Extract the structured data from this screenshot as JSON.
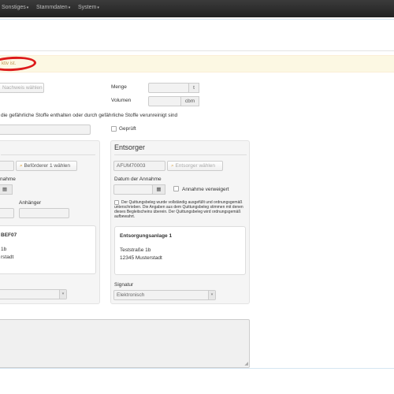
{
  "nav": {
    "items": [
      {
        "label": "Sonstiges"
      },
      {
        "label": "Stammdaten"
      },
      {
        "label": "System"
      }
    ]
  },
  "alert": {
    "text": "ktiv ist."
  },
  "top": {
    "nachweis_button": "Nachweis wählen",
    "menge_label": "Menge",
    "menge_unit": "t",
    "volumen_label": "Volumen",
    "volumen_unit": "cbm",
    "stoffe_text": "die gefährliche Stoffe enthalten oder durch gefährliche Stoffe verunreinigt sind",
    "geprueft_label": "Geprüft"
  },
  "left_panel": {
    "befoerderer_button": "Beförderer 1 wählen",
    "annahme_label_partial": "nahme",
    "anhaenger_label": "Anhänger",
    "code_partial": "BEF07",
    "street_partial": "1b",
    "city_partial": "rstadt"
  },
  "entsorger": {
    "title": "Entsorger",
    "id_value": "AFUM70003",
    "choose_button": "Entsorger wählen",
    "datum_label": "Datum der Annahme",
    "verweigert_label": "Annahme verweigert",
    "quittung_text": "Der Quittungsbeleg wurde vollständig ausgefüllt und ordnungsgemäß unterschrieben. Die Angaben aus dem Quittungsbeleg stimmen mit denen dieses Begleitscheins überein. Der Quittungsbeleg wird ordnungsgemäß aufbewahrt.",
    "facility_name": "Entsorgungsanlage 1",
    "street": "Teststraße 1b",
    "city": "12345 Musterstadt",
    "signatur_label": "Signatur",
    "signatur_value": "Elektronisch"
  },
  "icons": {
    "calendar": "calendar-icon",
    "search": "search-icon",
    "caret": "caret-down-icon",
    "resize": "resize-grip-icon"
  },
  "colors": {
    "navbar": "#2b2b2b",
    "alert_bg": "#fcf8e3",
    "highlight": "#dd1b1b"
  }
}
